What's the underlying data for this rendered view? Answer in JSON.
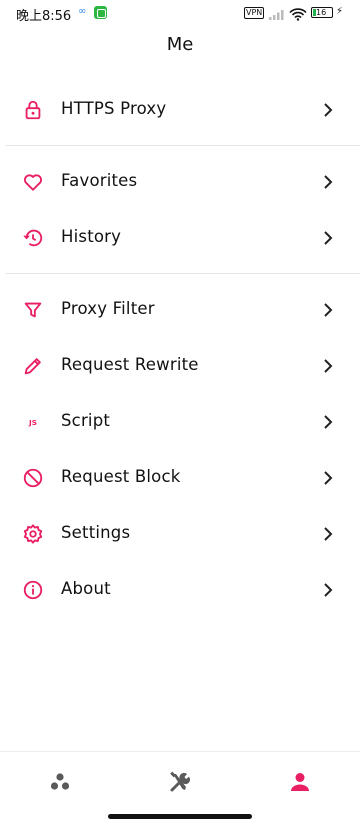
{
  "status_bar": {
    "time": "晚上8:56",
    "link_glyph": "∞",
    "vpn": "VPN",
    "battery": "16"
  },
  "header": {
    "title": "Me"
  },
  "accent_color": "#e91e63",
  "menu": {
    "https_proxy": {
      "label": "HTTPS Proxy",
      "icon": "lock-icon"
    },
    "favorites": {
      "label": "Favorites",
      "icon": "heart-icon"
    },
    "history": {
      "label": "History",
      "icon": "history-icon"
    },
    "proxy_filter": {
      "label": "Proxy Filter",
      "icon": "filter-icon"
    },
    "request_rewrite": {
      "label": "Request Rewrite",
      "icon": "pencil-icon"
    },
    "script": {
      "label": "Script",
      "icon_text": "JS"
    },
    "request_block": {
      "label": "Request Block",
      "icon": "block-icon"
    },
    "settings": {
      "label": "Settings",
      "icon": "gear-icon"
    },
    "about": {
      "label": "About",
      "icon": "info-icon"
    }
  },
  "bottom_nav": {
    "tabs": [
      {
        "icon": "dots-icon",
        "active": false
      },
      {
        "icon": "tools-icon",
        "active": false
      },
      {
        "icon": "person-icon",
        "active": true
      }
    ]
  }
}
